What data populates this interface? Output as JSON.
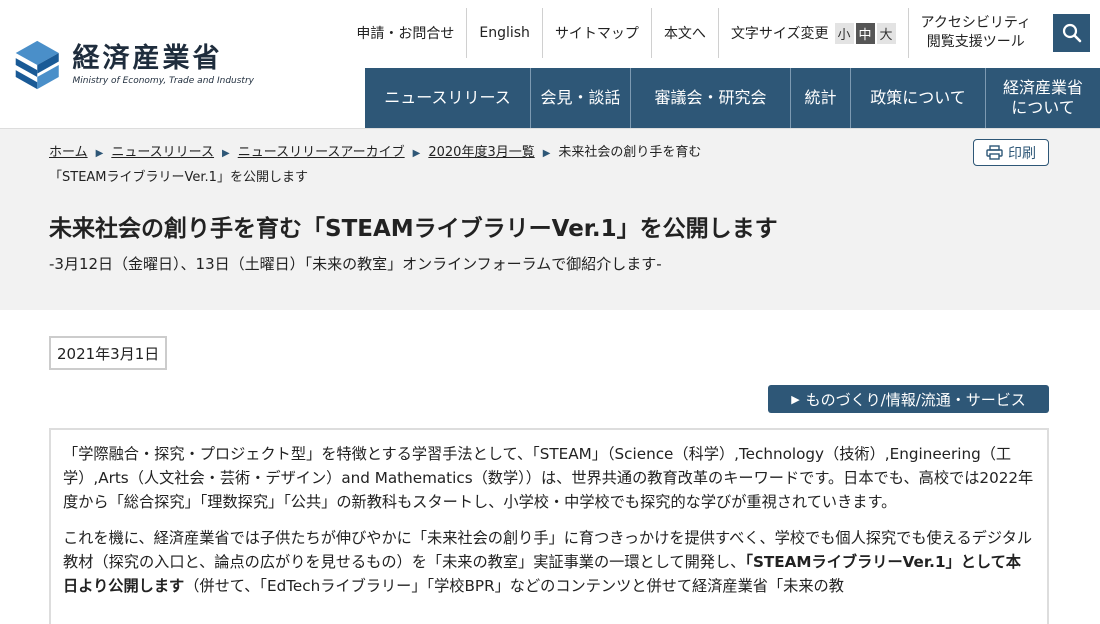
{
  "header": {
    "logo_jp": "経済産業省",
    "logo_en": "Ministry of Economy, Trade and Industry",
    "util": {
      "contact": "申請・お問合せ",
      "english": "English",
      "sitemap": "サイトマップ",
      "skip": "本文へ",
      "font_size_label": "文字サイズ変更",
      "font_small": "小",
      "font_medium": "中",
      "font_large": "大",
      "access_line1": "アクセシビリティ",
      "access_line2": "閲覧支援ツール"
    },
    "gnav": [
      {
        "label": "ニュースリリース"
      },
      {
        "label": "会見・談話"
      },
      {
        "label": "審議会・研究会"
      },
      {
        "label": "統計"
      },
      {
        "label": "政策について"
      },
      {
        "label_line1": "経済産業省",
        "label_line2": "について"
      }
    ],
    "icons": {
      "logo": "meti-logo-icon",
      "search": "search-icon",
      "print": "printer-icon"
    },
    "colors": {
      "primary": "#2e5777",
      "logo_light": "#4a8fc9",
      "logo_dark": "#1a5a96"
    }
  },
  "breadcrumb": {
    "items": [
      "ホーム",
      "ニュースリリース",
      "ニュースリリースアーカイブ",
      "2020年度3月一覧"
    ],
    "current_line1": "未来社会の創り手を育む",
    "current_line2": "「STEAMライブラリーVer.1」を公開します"
  },
  "print_label": "印刷",
  "page": {
    "title": "未来社会の創り手を育む「STEAMライブラリーVer.1」を公開します",
    "subtitle": "-3月12日（金曜日）、13日（土曜日）「未来の教室」オンラインフォーラムで御紹介します-",
    "date": "2021年3月1日",
    "category": "ものづくり/情報/流通・サービス"
  },
  "body": {
    "p1": "「学際融合・探究・プロジェクト型」を特徴とする学習手法として、「STEAM」（Science（科学）,Technology（技術）,Engineering（工学）,Arts（人文社会・芸術・デザイン）and Mathematics（数学））は、世界共通の教育改革のキーワードです。日本でも、高校では2022年度から「総合探究」「理数探究」「公共」の新教科もスタートし、小学校・中学校でも探究的な学びが重視されていきます。",
    "p2_a": "これを機に、経済産業省では子供たちが伸びやかに「未来社会の創り手」に育つきっかけを提供すべく、学校でも個人探究でも使えるデジタル教材（探究の入口と、論点の広がりを見せるもの）を「未来の教室」実証事業の一環として開発し、",
    "p2_b": "「STEAMライブラリーVer.1」として本日より公開します",
    "p2_c": "（併せて、「EdTechライブラリー」「学校BPR」などのコンテンツと併せて経済産業省「未来の教"
  }
}
